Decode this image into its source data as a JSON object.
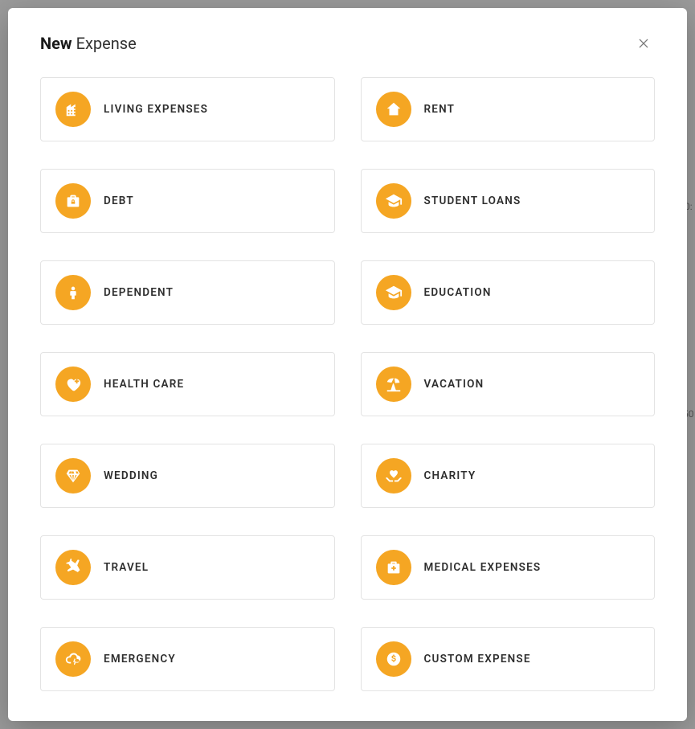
{
  "modal": {
    "title_bold": "New",
    "title_rest": "Expense"
  },
  "categories": [
    {
      "id": "living-expenses",
      "label": "LIVING EXPENSES",
      "icon": "city"
    },
    {
      "id": "rent",
      "label": "RENT",
      "icon": "house-dollar"
    },
    {
      "id": "debt",
      "label": "DEBT",
      "icon": "briefcase-lock"
    },
    {
      "id": "student-loans",
      "label": "STUDENT LOANS",
      "icon": "graduation"
    },
    {
      "id": "dependent",
      "label": "DEPENDENT",
      "icon": "person"
    },
    {
      "id": "education",
      "label": "EDUCATION",
      "icon": "graduation"
    },
    {
      "id": "health-care",
      "label": "HEALTH CARE",
      "icon": "heart-plus"
    },
    {
      "id": "vacation",
      "label": "VACATION",
      "icon": "beach"
    },
    {
      "id": "wedding",
      "label": "WEDDING",
      "icon": "diamond"
    },
    {
      "id": "charity",
      "label": "CHARITY",
      "icon": "hands-heart"
    },
    {
      "id": "travel",
      "label": "TRAVEL",
      "icon": "plane"
    },
    {
      "id": "medical-expenses",
      "label": "MEDICAL EXPENSES",
      "icon": "medkit"
    },
    {
      "id": "emergency",
      "label": "EMERGENCY",
      "icon": "cloud-bolt"
    },
    {
      "id": "custom-expense",
      "label": "CUSTOM EXPENSE",
      "icon": "coin-dollar"
    }
  ],
  "colors": {
    "accent": "#f5a623",
    "card_border": "#e3e3e3",
    "text": "#2e2e2e"
  }
}
